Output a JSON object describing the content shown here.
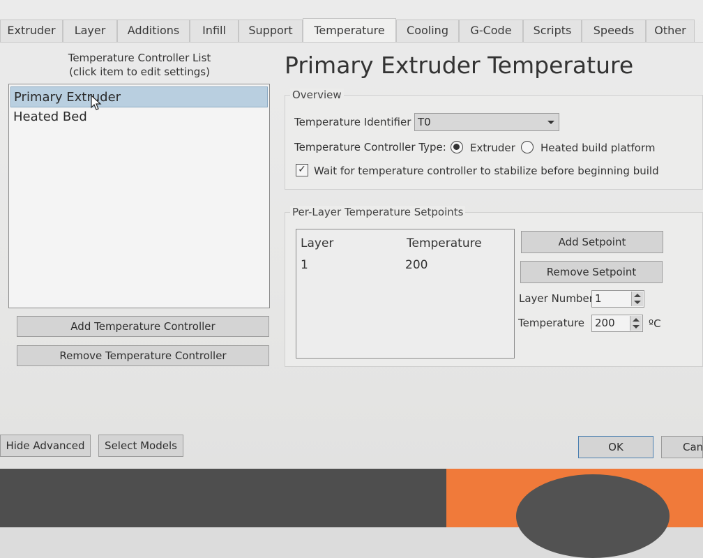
{
  "tabs": [
    "Extruder",
    "Layer",
    "Additions",
    "Infill",
    "Support",
    "Temperature",
    "Cooling",
    "G-Code",
    "Scripts",
    "Speeds",
    "Other"
  ],
  "active_tab": "Temperature",
  "left_panel": {
    "caption_line1": "Temperature Controller List",
    "caption_line2": "(click item to edit settings)",
    "items": [
      "Primary Extruder",
      "Heated Bed"
    ],
    "selected": "Primary Extruder",
    "add_button": "Add Temperature Controller",
    "remove_button": "Remove Temperature Controller"
  },
  "heading": "Primary Extruder Temperature",
  "overview": {
    "title": "Overview",
    "identifier_label": "Temperature Identifier",
    "identifier_value": "T0",
    "type_label": "Temperature Controller Type:",
    "type_options": [
      "Extruder",
      "Heated build platform"
    ],
    "type_selected": "Extruder",
    "wait_label": "Wait for temperature controller to stabilize before beginning build",
    "wait_checked": true
  },
  "setpoints": {
    "title": "Per-Layer Temperature Setpoints",
    "columns": [
      "Layer",
      "Temperature"
    ],
    "rows": [
      [
        "1",
        "200"
      ]
    ],
    "add_button": "Add Setpoint",
    "remove_button": "Remove Setpoint",
    "layer_number_label": "Layer Number",
    "layer_number_value": "1",
    "temperature_label": "Temperature",
    "temperature_value": "200",
    "temperature_unit": "ºC"
  },
  "footer": {
    "hide_advanced": "Hide Advanced",
    "select_models": "Select Models",
    "ok": "OK",
    "cancel": "Canc"
  }
}
